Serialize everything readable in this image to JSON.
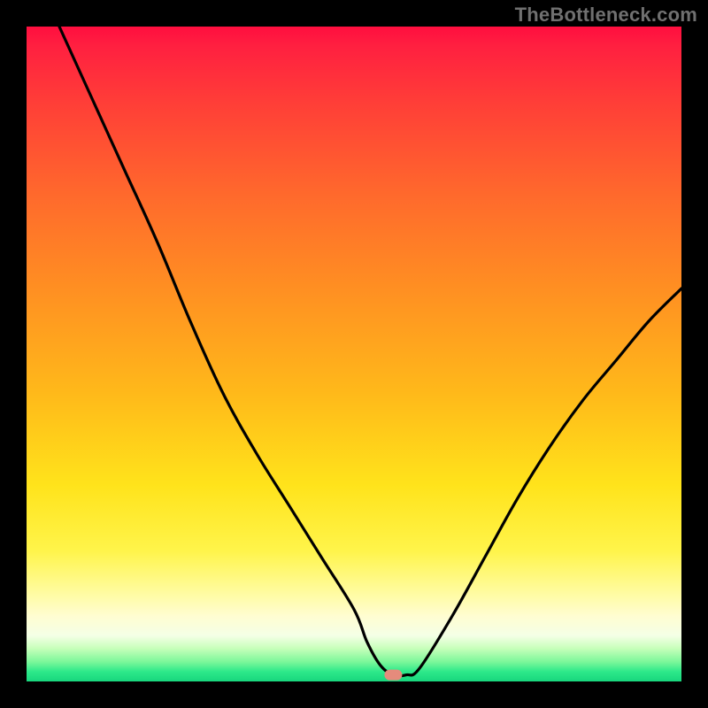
{
  "watermark": "TheBottleneck.com",
  "chart_data": {
    "type": "line",
    "title": "",
    "xlabel": "",
    "ylabel": "",
    "xlim": [
      0,
      100
    ],
    "ylim": [
      0,
      100
    ],
    "grid": false,
    "legend": false,
    "series": [
      {
        "name": "bottleneck-curve",
        "x": [
          5,
          10,
          15,
          20,
          25,
          30,
          35,
          40,
          45,
          50,
          52,
          54,
          56,
          58,
          60,
          65,
          70,
          75,
          80,
          85,
          90,
          95,
          100
        ],
        "y": [
          100,
          89,
          78,
          67,
          55,
          44,
          35,
          27,
          19,
          11,
          6,
          2.5,
          1,
          1,
          2,
          10,
          19,
          28,
          36,
          43,
          49,
          55,
          60
        ]
      }
    ],
    "marker": {
      "x": 56,
      "y": 1,
      "color": "#e58b7c"
    },
    "gradient_stops": [
      {
        "pos": 0,
        "color": "#ff0e3f"
      },
      {
        "pos": 12,
        "color": "#ff3f37"
      },
      {
        "pos": 26,
        "color": "#ff6a2c"
      },
      {
        "pos": 40,
        "color": "#ff8f22"
      },
      {
        "pos": 56,
        "color": "#ffb91a"
      },
      {
        "pos": 70,
        "color": "#ffe31b"
      },
      {
        "pos": 80,
        "color": "#fff44a"
      },
      {
        "pos": 90,
        "color": "#fffdd1"
      },
      {
        "pos": 95,
        "color": "#c6ffb9"
      },
      {
        "pos": 100,
        "color": "#18d67d"
      }
    ]
  }
}
